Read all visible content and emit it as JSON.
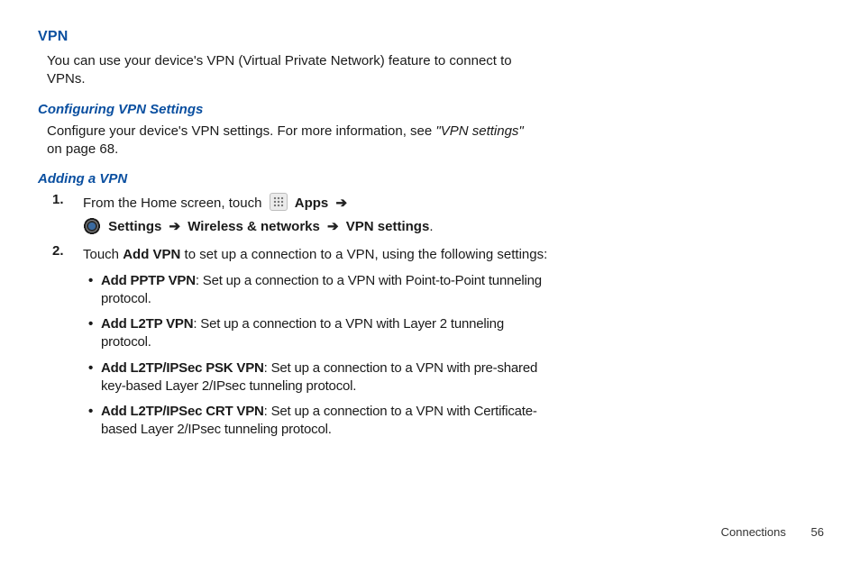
{
  "section": {
    "title": "VPN"
  },
  "intro": "You can use your device's VPN (Virtual Private Network) feature to connect to VPNs.",
  "configuring": {
    "heading": "Configuring VPN Settings",
    "text_a": "Configure your device's VPN settings. For more information, see ",
    "text_ref": "\"VPN settings\"",
    "text_b": " on page 68."
  },
  "adding": {
    "heading": "Adding a VPN",
    "step1": {
      "num": "1.",
      "pre": "From the Home screen, touch",
      "apps": "Apps",
      "arrow": "➔",
      "settings": "Settings",
      "wn": "Wireless & networks",
      "vpn": "VPN settings",
      "dot": "."
    },
    "step2": {
      "num": "2.",
      "a": "Touch ",
      "addvpn": "Add VPN",
      "b": " to set up a connection to a VPN, using the following settings:"
    },
    "bullets": [
      {
        "t": "Add PPTP VPN",
        "d": ": Set up a connection to a VPN with Point-to-Point tunneling protocol."
      },
      {
        "t": "Add L2TP VPN",
        "d": ": Set up a connection to a VPN with Layer 2 tunneling protocol."
      },
      {
        "t": "Add L2TP/IPSec PSK VPN",
        "d": ": Set up a connection to a VPN with pre-shared key-based Layer 2/IPsec tunneling protocol."
      },
      {
        "t": "Add L2TP/IPSec CRT VPN",
        "d": ": Set up a connection to a VPN with Certificate-based Layer 2/IPsec tunneling protocol."
      }
    ]
  },
  "footer": {
    "section": "Connections",
    "page": "56"
  },
  "glyphs": {
    "bullet": "•"
  }
}
